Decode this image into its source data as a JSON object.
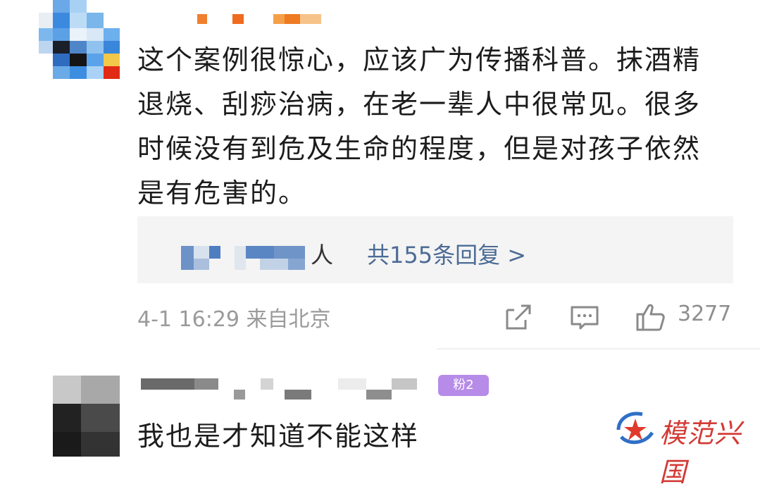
{
  "comment1": {
    "lines": [
      "这个案例很惊心，应该广为传播科普。抹酒精",
      "退烧、刮痧治病，在老一辈人中很常见。很多",
      "时候没有到危及生命的程度，但是对孩子依然",
      "是有危害的。"
    ],
    "reply": {
      "tail_text": "人",
      "count_text": "共155条回复 >"
    },
    "meta": "4-1 16:29 来自北京",
    "likes": "3277"
  },
  "comment2": {
    "badge": "粉2",
    "text": "我也是才知道不能这样"
  },
  "watermark": {
    "text": "模范兴国"
  },
  "colors": {
    "link": "#4c6b95",
    "meta": "#9a9a9a",
    "reply_bg": "#f4f4f4",
    "badge_bg": "#b78be8",
    "watermark": "#d33b36"
  }
}
